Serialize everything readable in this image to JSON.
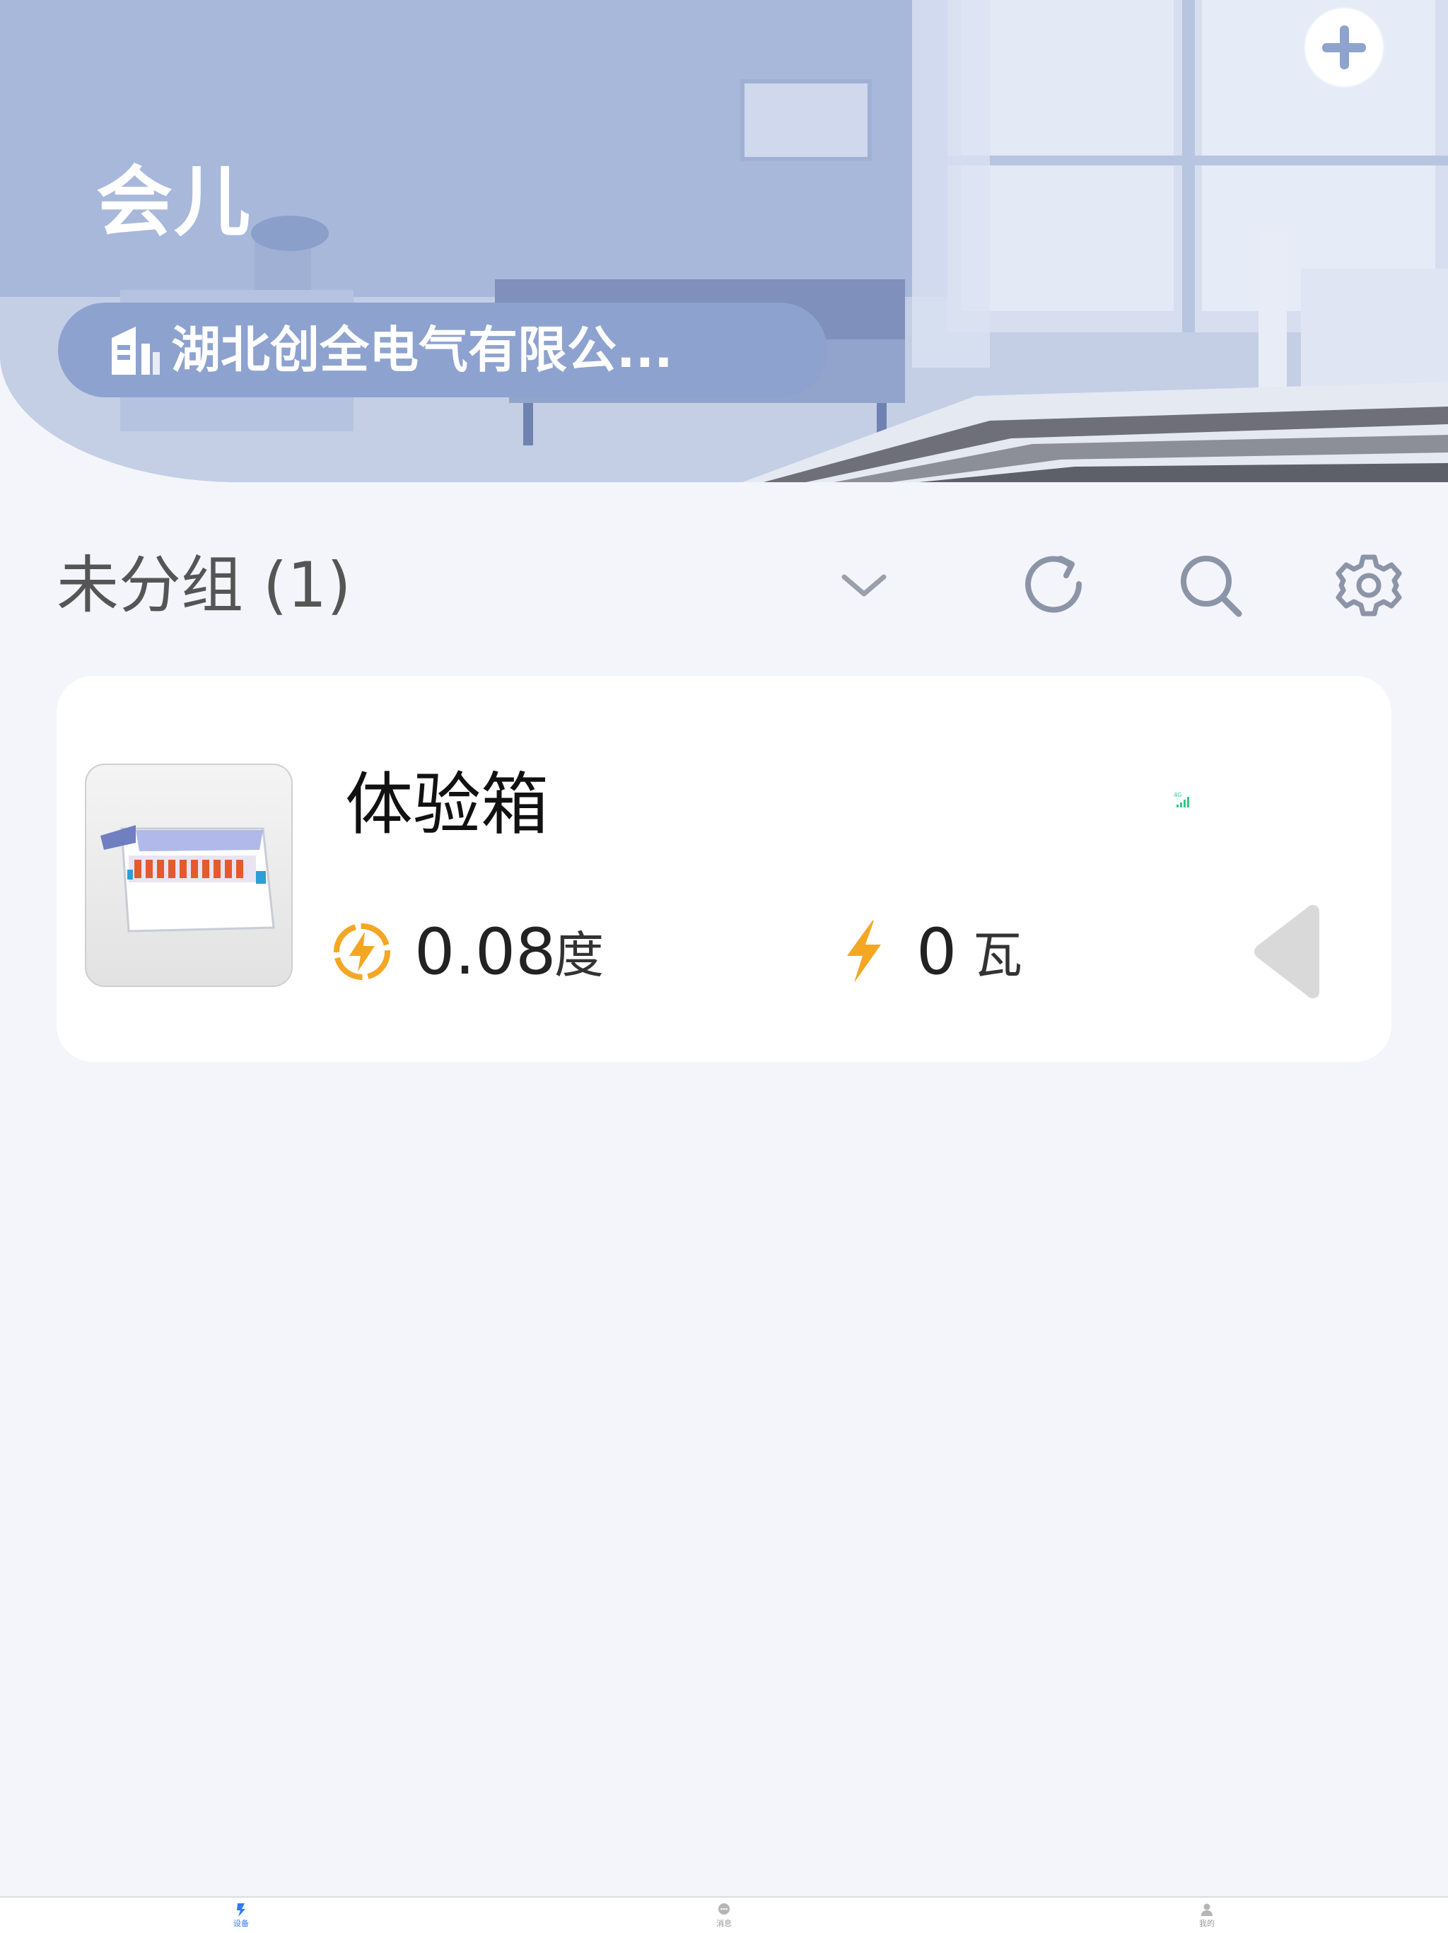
{
  "header": {
    "title": "会儿",
    "org_name": "湖北创全电气有限公..."
  },
  "group": {
    "title": "未分组 (1)"
  },
  "device": {
    "name": "体验箱",
    "signal_label": "4G",
    "energy_value": "0.08",
    "energy_unit": "度",
    "power_value": "0",
    "power_unit": "瓦"
  },
  "tabs": [
    {
      "label": "设备",
      "icon": "device-icon",
      "active": true
    },
    {
      "label": "消息",
      "icon": "message-icon",
      "active": false
    },
    {
      "label": "我的",
      "icon": "profile-icon",
      "active": false
    }
  ],
  "colors": {
    "accent": "#8da2cf",
    "background": "#f3f5fa",
    "energy_icon": "#f5a623",
    "power_icon": "#f5a623",
    "signal": "#2ecc8a",
    "tab_active": "#3478f6",
    "tab_inactive": "#999999"
  }
}
